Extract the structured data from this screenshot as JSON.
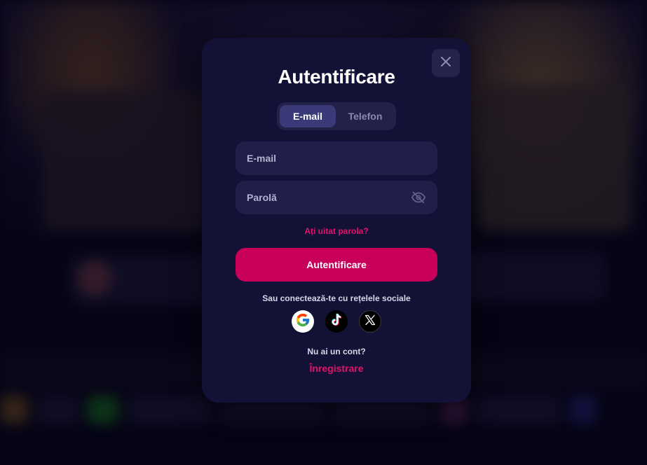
{
  "modal": {
    "title": "Autentificare",
    "tabs": [
      {
        "label": "E-mail",
        "active": true
      },
      {
        "label": "Telefon",
        "active": false
      }
    ],
    "email_placeholder": "E-mail",
    "password_placeholder": "Parolă",
    "forgot_password": "Ați uitat parola?",
    "submit_label": "Autentificare",
    "social_label": "Sau conectează-te cu rețelele sociale",
    "social_icons": [
      "google-icon",
      "tiktok-icon",
      "x-icon"
    ],
    "no_account": "Nu ai un cont?",
    "register_label": "Înregistrare"
  },
  "colors": {
    "modal_bg": "#131236",
    "field_bg": "#201f4a",
    "accent": "#c8005a",
    "link": "#e3136a",
    "tab_active": "#3b3a78"
  }
}
